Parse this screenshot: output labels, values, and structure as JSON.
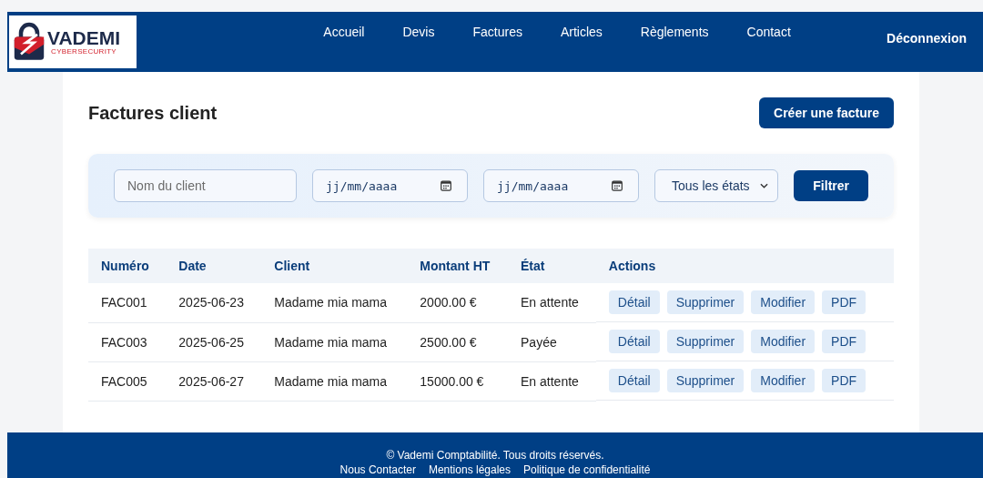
{
  "logo": {
    "name": "VADEMI",
    "tagline": "CYBERSECURITY"
  },
  "nav": {
    "items": [
      "Accueil",
      "Devis",
      "Factures",
      "Articles",
      "Règlements",
      "Contact"
    ],
    "logout": "Déconnexion"
  },
  "page": {
    "title": "Factures client",
    "create_button": "Créer une facture"
  },
  "filters": {
    "client": {
      "placeholder": "Nom du client"
    },
    "date_from": {
      "placeholder": "jj/mm/aaaa"
    },
    "date_to": {
      "placeholder": "jj/mm/aaaa"
    },
    "state": {
      "value": "Tous les états"
    },
    "button": "Filtrer"
  },
  "table": {
    "columns": [
      "Numéro",
      "Date",
      "Client",
      "Montant HT",
      "État",
      "Actions"
    ],
    "rows": [
      {
        "number": "FAC001",
        "date": "2025-06-23",
        "client": "Madame mia mama",
        "amount": "2000.00 €",
        "state": "En attente",
        "actions": [
          "Détail",
          "Supprimer",
          "Modifier",
          "PDF"
        ]
      },
      {
        "number": "FAC003",
        "date": "2025-06-25",
        "client": "Madame mia mama",
        "amount": "2500.00 €",
        "state": "Payée",
        "actions": [
          "Détail",
          "Supprimer",
          "Modifier",
          "PDF"
        ]
      },
      {
        "number": "FAC005",
        "date": "2025-06-27",
        "client": "Madame mia mama",
        "amount": "15000.00 €",
        "state": "En attente",
        "actions": [
          "Détail",
          "Supprimer",
          "Modifier",
          "PDF"
        ]
      }
    ]
  },
  "footer": {
    "copyright": "© Vademi Comptabilité. Tous droits réservés.",
    "links": [
      "Nous Contacter",
      "Mentions légales",
      "Politique de confidentialité"
    ]
  }
}
